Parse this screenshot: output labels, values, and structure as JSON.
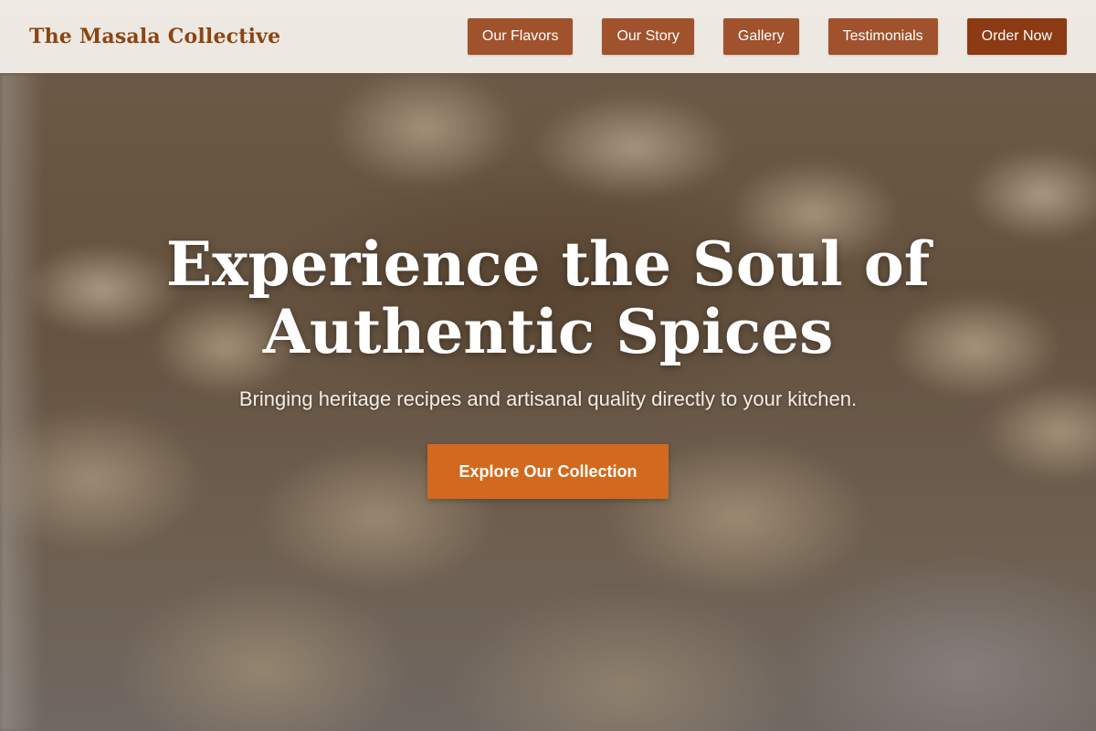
{
  "header": {
    "brand": "The Masala Collective",
    "nav": [
      {
        "label": "Our Flavors"
      },
      {
        "label": "Our Story"
      },
      {
        "label": "Gallery"
      },
      {
        "label": "Testimonials"
      },
      {
        "label": "Order Now"
      }
    ]
  },
  "hero": {
    "title_line1": "Experience the Soul of",
    "title_line2": "Authentic Spices",
    "subtitle": "Bringing heritage recipes and artisanal quality directly to your kitchen.",
    "cta_label": "Explore Our Collection"
  },
  "colors": {
    "brand_text": "#8b4513",
    "nav_button": "#a0522d",
    "order_button": "#8b3a14",
    "cta_button": "#d2691e"
  }
}
